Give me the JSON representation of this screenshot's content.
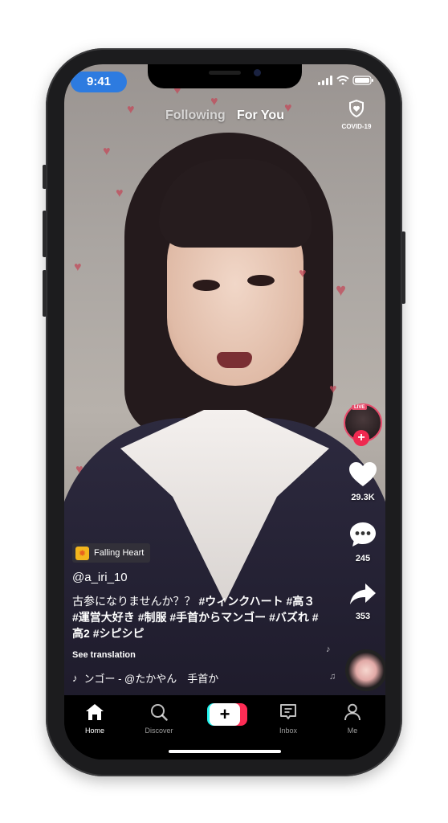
{
  "status": {
    "time": "9:41"
  },
  "top_nav": {
    "following": "Following",
    "for_you": "For You",
    "covid_label": "COVID-19"
  },
  "creator": {
    "live_badge": "LIVE",
    "follow_symbol": "+"
  },
  "actions": {
    "likes": "29.3K",
    "comments": "245",
    "shares": "353"
  },
  "effect": {
    "label": "Falling Heart",
    "icon": "sun-icon"
  },
  "post": {
    "username": "@a_iri_10",
    "caption_text": "古参になりませんか？？",
    "hashtags": [
      "#ウィンクハート",
      "#高３",
      "#運営大好き",
      "#制服",
      "#手首からマンゴー",
      "#バズれ",
      "#高2",
      "#シピシピ"
    ],
    "see_translation": "See translation",
    "music": "ンゴー - @たかやん　手首か"
  },
  "tabbar": {
    "home": "Home",
    "discover": "Discover",
    "create_symbol": "+",
    "inbox": "Inbox",
    "me": "Me"
  },
  "colors": {
    "accent_pink": "#fe2c55",
    "accent_cyan": "#25f4ee",
    "status_pill": "#2d7be0"
  }
}
